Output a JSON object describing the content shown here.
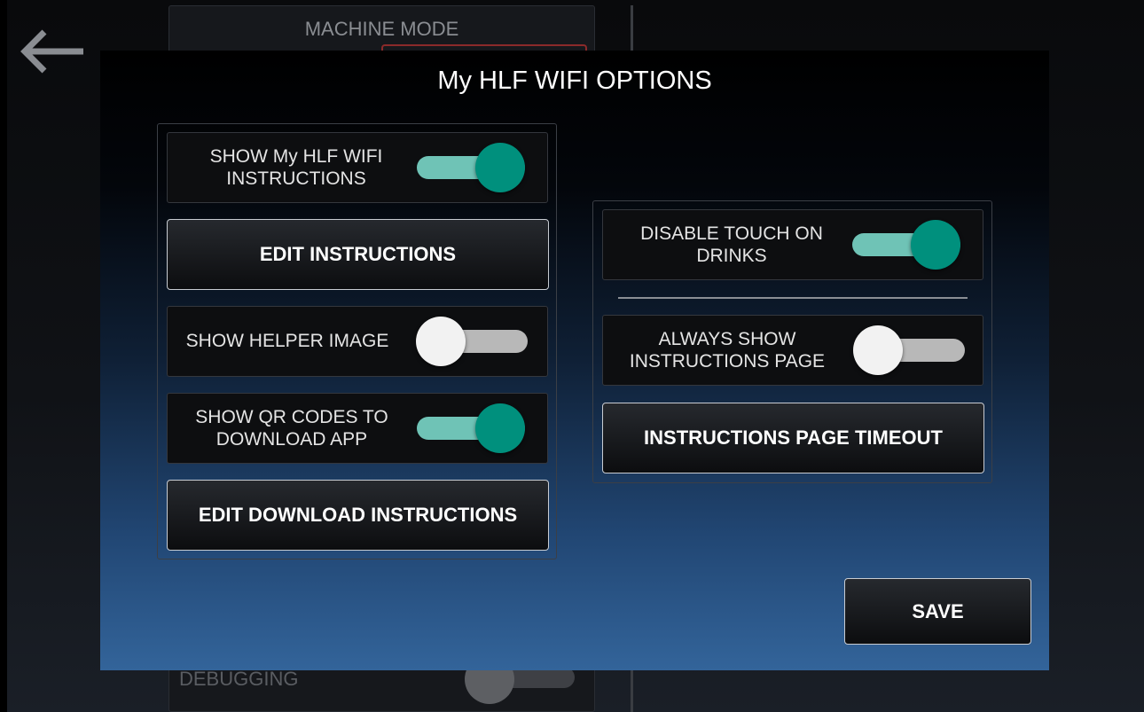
{
  "background": {
    "section_title": "MACHINE MODE",
    "debugging_label": "DEBUGGING",
    "back_icon": "arrow-left-icon"
  },
  "dialog": {
    "title": "My HLF WIFI OPTIONS",
    "left_group": {
      "show_instructions": {
        "label": "SHOW My HLF WIFI INSTRUCTIONS",
        "label_line1": "SHOW My HLF WIFI",
        "label_line2": "INSTRUCTIONS",
        "checked": true
      },
      "edit_instructions_button": "EDIT INSTRUCTIONS",
      "show_helper_image": {
        "label": "SHOW HELPER IMAGE",
        "checked": false
      },
      "show_qr_codes": {
        "label": "SHOW QR CODES TO DOWNLOAD APP",
        "label_line1": "SHOW QR CODES TO",
        "label_line2": "DOWNLOAD APP",
        "checked": true
      },
      "edit_download_button": "EDIT DOWNLOAD INSTRUCTIONS"
    },
    "right_group": {
      "disable_touch": {
        "label": "DISABLE TOUCH ON DRINKS",
        "label_line1": "DISABLE TOUCH ON",
        "label_line2": "DRINKS",
        "checked": true
      },
      "always_show": {
        "label": "ALWAYS SHOW INSTRUCTIONS PAGE",
        "label_line1": "ALWAYS SHOW",
        "label_line2": "INSTRUCTIONS PAGE",
        "checked": false
      },
      "timeout_button": "INSTRUCTIONS PAGE TIMEOUT"
    },
    "save_button": "SAVE"
  },
  "colors": {
    "toggle_on_thumb": "#00907d",
    "toggle_on_track": "#6fc3b6",
    "toggle_off_thumb": "#f2f2f2",
    "toggle_off_track": "#b8b8b8"
  }
}
